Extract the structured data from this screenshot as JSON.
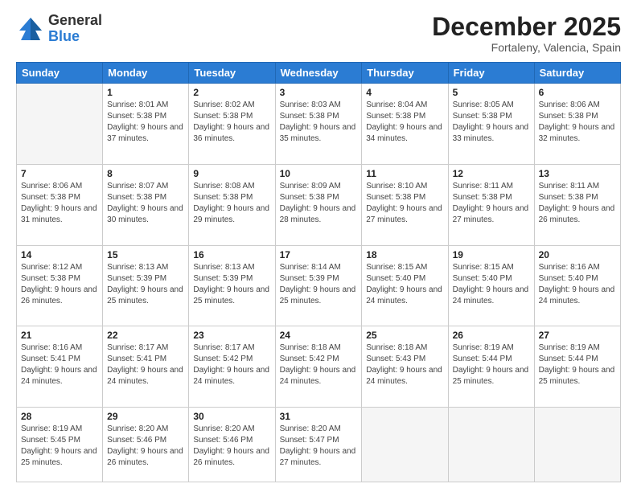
{
  "logo": {
    "line1": "General",
    "line2": "Blue"
  },
  "header": {
    "month": "December 2025",
    "location": "Fortaleny, Valencia, Spain"
  },
  "weekdays": [
    "Sunday",
    "Monday",
    "Tuesday",
    "Wednesday",
    "Thursday",
    "Friday",
    "Saturday"
  ],
  "weeks": [
    [
      {
        "day": "",
        "empty": true
      },
      {
        "day": "1",
        "sunrise": "8:01 AM",
        "sunset": "5:38 PM",
        "daylight": "9 hours and 37 minutes."
      },
      {
        "day": "2",
        "sunrise": "8:02 AM",
        "sunset": "5:38 PM",
        "daylight": "9 hours and 36 minutes."
      },
      {
        "day": "3",
        "sunrise": "8:03 AM",
        "sunset": "5:38 PM",
        "daylight": "9 hours and 35 minutes."
      },
      {
        "day": "4",
        "sunrise": "8:04 AM",
        "sunset": "5:38 PM",
        "daylight": "9 hours and 34 minutes."
      },
      {
        "day": "5",
        "sunrise": "8:05 AM",
        "sunset": "5:38 PM",
        "daylight": "9 hours and 33 minutes."
      },
      {
        "day": "6",
        "sunrise": "8:06 AM",
        "sunset": "5:38 PM",
        "daylight": "9 hours and 32 minutes."
      }
    ],
    [
      {
        "day": "7",
        "sunrise": "8:06 AM",
        "sunset": "5:38 PM",
        "daylight": "9 hours and 31 minutes."
      },
      {
        "day": "8",
        "sunrise": "8:07 AM",
        "sunset": "5:38 PM",
        "daylight": "9 hours and 30 minutes."
      },
      {
        "day": "9",
        "sunrise": "8:08 AM",
        "sunset": "5:38 PM",
        "daylight": "9 hours and 29 minutes."
      },
      {
        "day": "10",
        "sunrise": "8:09 AM",
        "sunset": "5:38 PM",
        "daylight": "9 hours and 28 minutes."
      },
      {
        "day": "11",
        "sunrise": "8:10 AM",
        "sunset": "5:38 PM",
        "daylight": "9 hours and 27 minutes."
      },
      {
        "day": "12",
        "sunrise": "8:11 AM",
        "sunset": "5:38 PM",
        "daylight": "9 hours and 27 minutes."
      },
      {
        "day": "13",
        "sunrise": "8:11 AM",
        "sunset": "5:38 PM",
        "daylight": "9 hours and 26 minutes."
      }
    ],
    [
      {
        "day": "14",
        "sunrise": "8:12 AM",
        "sunset": "5:38 PM",
        "daylight": "9 hours and 26 minutes."
      },
      {
        "day": "15",
        "sunrise": "8:13 AM",
        "sunset": "5:39 PM",
        "daylight": "9 hours and 25 minutes."
      },
      {
        "day": "16",
        "sunrise": "8:13 AM",
        "sunset": "5:39 PM",
        "daylight": "9 hours and 25 minutes."
      },
      {
        "day": "17",
        "sunrise": "8:14 AM",
        "sunset": "5:39 PM",
        "daylight": "9 hours and 25 minutes."
      },
      {
        "day": "18",
        "sunrise": "8:15 AM",
        "sunset": "5:40 PM",
        "daylight": "9 hours and 24 minutes."
      },
      {
        "day": "19",
        "sunrise": "8:15 AM",
        "sunset": "5:40 PM",
        "daylight": "9 hours and 24 minutes."
      },
      {
        "day": "20",
        "sunrise": "8:16 AM",
        "sunset": "5:40 PM",
        "daylight": "9 hours and 24 minutes."
      }
    ],
    [
      {
        "day": "21",
        "sunrise": "8:16 AM",
        "sunset": "5:41 PM",
        "daylight": "9 hours and 24 minutes."
      },
      {
        "day": "22",
        "sunrise": "8:17 AM",
        "sunset": "5:41 PM",
        "daylight": "9 hours and 24 minutes."
      },
      {
        "day": "23",
        "sunrise": "8:17 AM",
        "sunset": "5:42 PM",
        "daylight": "9 hours and 24 minutes."
      },
      {
        "day": "24",
        "sunrise": "8:18 AM",
        "sunset": "5:42 PM",
        "daylight": "9 hours and 24 minutes."
      },
      {
        "day": "25",
        "sunrise": "8:18 AM",
        "sunset": "5:43 PM",
        "daylight": "9 hours and 24 minutes."
      },
      {
        "day": "26",
        "sunrise": "8:19 AM",
        "sunset": "5:44 PM",
        "daylight": "9 hours and 25 minutes."
      },
      {
        "day": "27",
        "sunrise": "8:19 AM",
        "sunset": "5:44 PM",
        "daylight": "9 hours and 25 minutes."
      }
    ],
    [
      {
        "day": "28",
        "sunrise": "8:19 AM",
        "sunset": "5:45 PM",
        "daylight": "9 hours and 25 minutes."
      },
      {
        "day": "29",
        "sunrise": "8:20 AM",
        "sunset": "5:46 PM",
        "daylight": "9 hours and 26 minutes."
      },
      {
        "day": "30",
        "sunrise": "8:20 AM",
        "sunset": "5:46 PM",
        "daylight": "9 hours and 26 minutes."
      },
      {
        "day": "31",
        "sunrise": "8:20 AM",
        "sunset": "5:47 PM",
        "daylight": "9 hours and 27 minutes."
      },
      {
        "day": "",
        "empty": true
      },
      {
        "day": "",
        "empty": true
      },
      {
        "day": "",
        "empty": true
      }
    ]
  ],
  "labels": {
    "sunrise": "Sunrise:",
    "sunset": "Sunset:",
    "daylight": "Daylight:"
  }
}
